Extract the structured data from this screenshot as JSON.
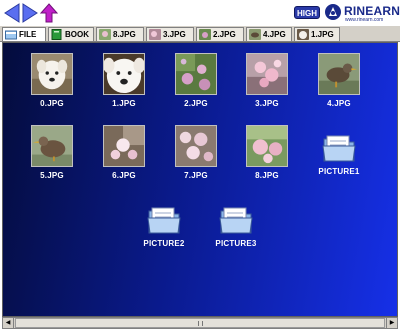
{
  "header": {
    "quality_badge": "HIGH",
    "logo_text": "RINEARN",
    "logo_sub": "www.rinearn.com"
  },
  "tabs": [
    {
      "label": "FILE",
      "icon": "folder-icon"
    },
    {
      "label": "BOOK",
      "icon": "book-icon"
    },
    {
      "label": "8.JPG",
      "icon": "image-icon"
    },
    {
      "label": "3.JPG",
      "icon": "image-icon"
    },
    {
      "label": "2.JPG",
      "icon": "image-icon"
    },
    {
      "label": "4.JPG",
      "icon": "image-icon"
    },
    {
      "label": "1.JPG",
      "icon": "image-icon"
    }
  ],
  "files": [
    {
      "name": "0.JPG",
      "kind": "image",
      "subject": "white-dog"
    },
    {
      "name": "1.JPG",
      "kind": "image",
      "subject": "white-dog-closeup"
    },
    {
      "name": "2.JPG",
      "kind": "image",
      "subject": "flowers"
    },
    {
      "name": "3.JPG",
      "kind": "image",
      "subject": "blossom"
    },
    {
      "name": "4.JPG",
      "kind": "image",
      "subject": "bird"
    },
    {
      "name": "5.JPG",
      "kind": "image",
      "subject": "bird"
    },
    {
      "name": "6.JPG",
      "kind": "image",
      "subject": "blossom"
    },
    {
      "name": "7.JPG",
      "kind": "image",
      "subject": "blossom"
    },
    {
      "name": "8.JPG",
      "kind": "image",
      "subject": "blossom"
    },
    {
      "name": "PICTURE1",
      "kind": "folder"
    },
    {
      "name": "PICTURE2",
      "kind": "folder"
    },
    {
      "name": "PICTURE3",
      "kind": "folder"
    }
  ],
  "colors": {
    "nav_arrow": "#5a6ef0",
    "up_arrow": "#c020c8",
    "background_dark": "#040c3c",
    "background_light": "#1630e8"
  }
}
